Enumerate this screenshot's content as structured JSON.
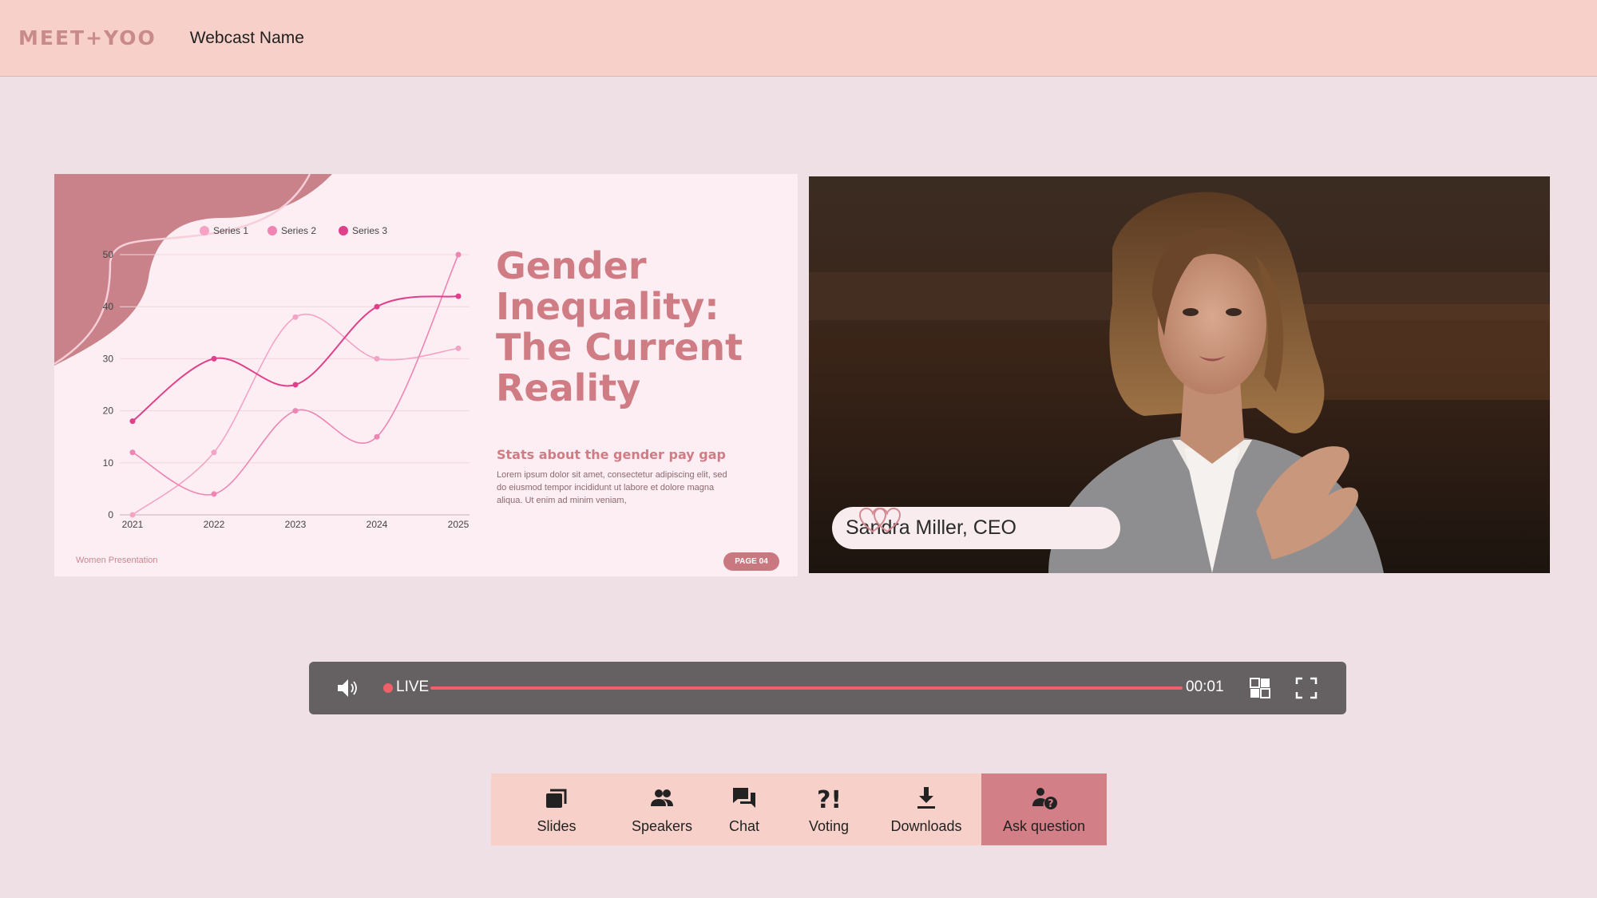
{
  "header": {
    "logo_text": "MEET+YOO",
    "webcast_name": "Webcast Name"
  },
  "slide": {
    "title": "Gender Inequality: The Current Reality",
    "subtitle": "Stats about the gender pay gap",
    "body": "Lorem ipsum dolor sit amet, consectetur adipiscing elit, sed do eiusmod tempor incididunt ut labore et dolore magna aliqua. Ut enim ad minim veniam,",
    "footer": "Women Presentation",
    "page_badge": "PAGE 04"
  },
  "chart_data": {
    "type": "line",
    "categories": [
      "2021",
      "2022",
      "2023",
      "2024",
      "2025"
    ],
    "series": [
      {
        "name": "Series 1",
        "values": [
          0,
          12,
          38,
          30,
          32
        ],
        "color": "#f5a3c4"
      },
      {
        "name": "Series 2",
        "values": [
          12,
          4,
          20,
          15,
          50
        ],
        "color": "#ee85b2"
      },
      {
        "name": "Series 3",
        "values": [
          18,
          30,
          25,
          40,
          42
        ],
        "color": "#e0408a"
      }
    ],
    "ylim": [
      0,
      50
    ],
    "yticks": [
      0,
      10,
      20,
      30,
      40,
      50
    ],
    "legend": "top",
    "grid": true
  },
  "video": {
    "speaker_name": "Sandra Miller, CEO"
  },
  "player": {
    "live_label": "LIVE",
    "time": "00:01",
    "progress": 1.0,
    "accent": "#f0606a"
  },
  "toolbar": {
    "items": [
      {
        "label": "Slides",
        "icon": "slides-icon"
      },
      {
        "label": "Speakers",
        "icon": "speakers-icon"
      },
      {
        "label": "Chat",
        "icon": "chat-icon"
      },
      {
        "label": "Voting",
        "icon": "voting-icon"
      },
      {
        "label": "Downloads",
        "icon": "download-icon"
      },
      {
        "label": "Ask question",
        "icon": "ask-question-icon"
      }
    ]
  }
}
